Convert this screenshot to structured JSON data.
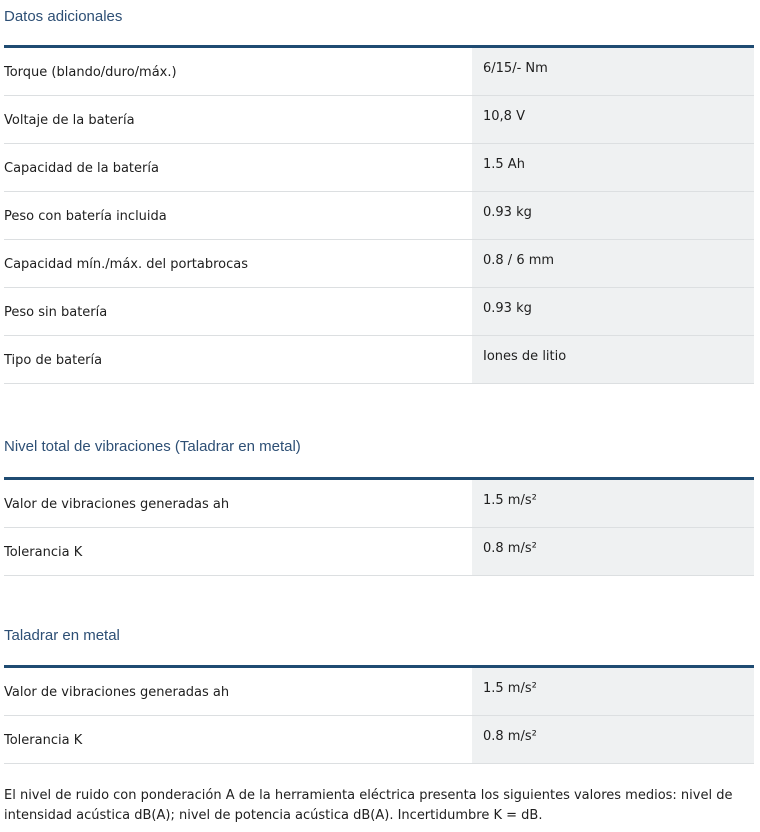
{
  "sections": [
    {
      "title": "Datos adicionales",
      "rows": [
        {
          "label": "Torque (blando/duro/máx.)",
          "value": "6/15/- Nm"
        },
        {
          "label": "Voltaje de la batería",
          "value": "10,8 V"
        },
        {
          "label": "Capacidad de la batería",
          "value": "1.5 Ah"
        },
        {
          "label": "Peso con batería incluida",
          "value": "0.93 kg"
        },
        {
          "label": "Capacidad mín./máx. del portabrocas",
          "value": "0.8 / 6 mm"
        },
        {
          "label": "Peso sin batería",
          "value": "0.93 kg"
        },
        {
          "label": "Tipo de batería",
          "value": "Iones de litio"
        }
      ]
    },
    {
      "title": "Nivel total de vibraciones (Taladrar en metal)",
      "rows": [
        {
          "label": "Valor de vibraciones generadas ah",
          "value": "1.5 m/s²"
        },
        {
          "label": "Tolerancia K",
          "value": "0.8 m/s²"
        }
      ]
    },
    {
      "title": "Taladrar en metal",
      "rows": [
        {
          "label": "Valor de vibraciones generadas ah",
          "value": "1.5 m/s²"
        },
        {
          "label": "Tolerancia K",
          "value": "0.8 m/s²"
        }
      ]
    }
  ],
  "noise_note": "El nivel de ruido con ponderación A de la herramienta eléctrica presenta los siguientes valores medios: nivel de intensidad acústica dB(A); nivel de potencia acústica dB(A). Incertidumbre K = dB.",
  "colors": {
    "accent": "#1f4b72",
    "title": "#2d4f75",
    "value_bg": "#eff1f2"
  }
}
